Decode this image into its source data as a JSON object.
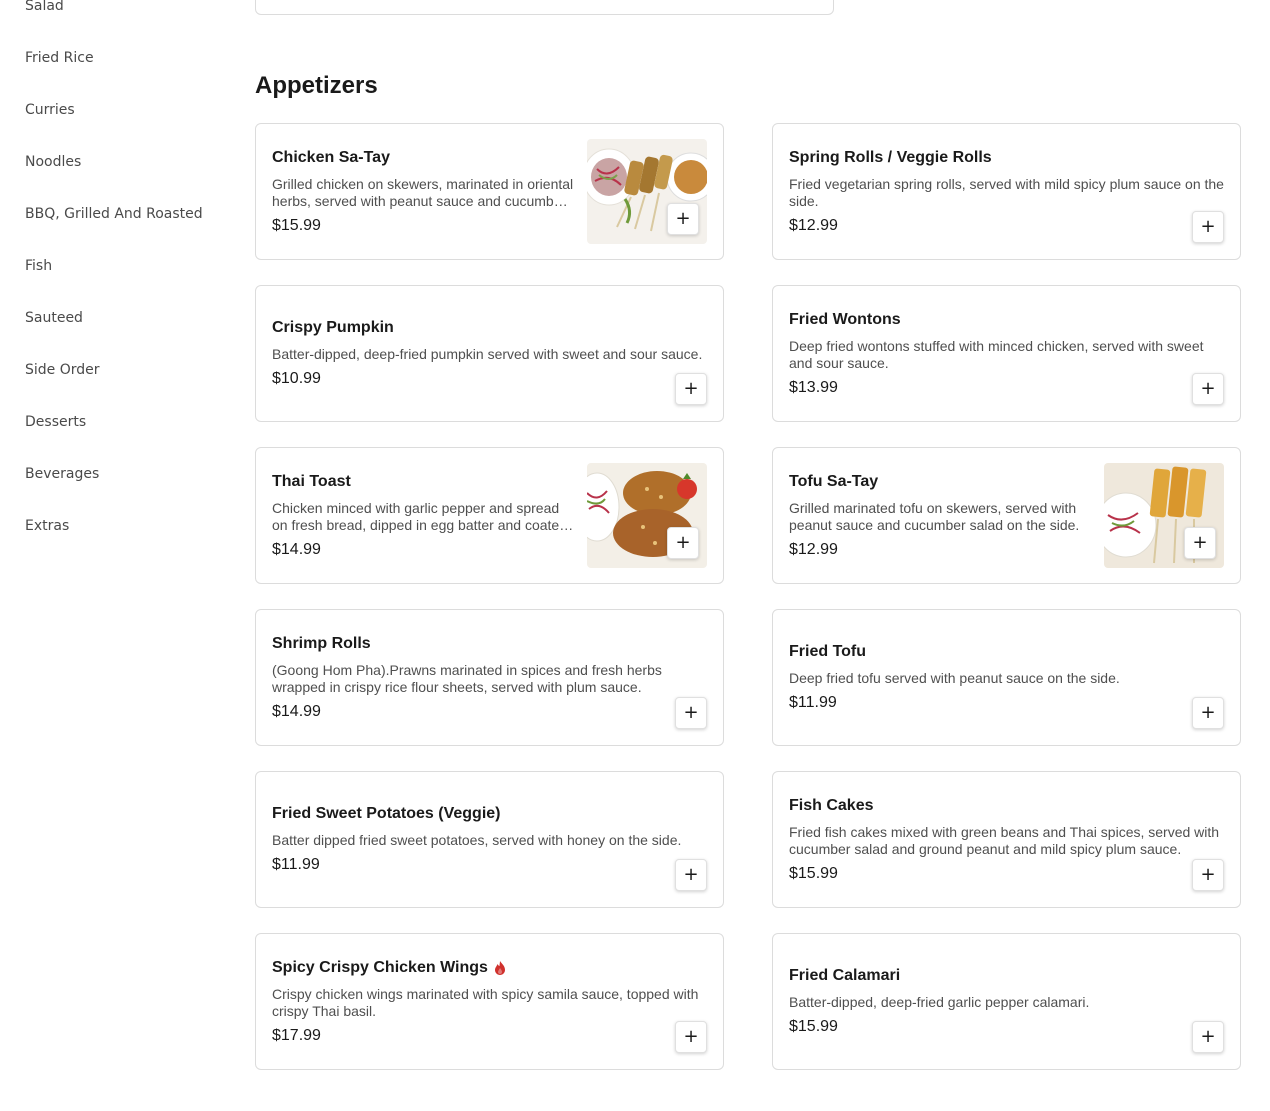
{
  "sidebar": {
    "items": [
      {
        "label": "Salad"
      },
      {
        "label": "Fried Rice"
      },
      {
        "label": "Curries"
      },
      {
        "label": "Noodles"
      },
      {
        "label": "BBQ, Grilled And Roasted"
      },
      {
        "label": "Fish"
      },
      {
        "label": "Sauteed"
      },
      {
        "label": "Side Order"
      },
      {
        "label": "Desserts"
      },
      {
        "label": "Beverages"
      },
      {
        "label": "Extras"
      }
    ]
  },
  "section": {
    "title": "Appetizers"
  },
  "add_label": "+",
  "items": [
    {
      "name": "Chicken Sa-Tay",
      "desc": "Grilled chicken on skewers, marinated in oriental herbs, served with peanut sauce and cucumber salad on the side.",
      "price": "$15.99",
      "image": "chicken-satay"
    },
    {
      "name": "Spring Rolls / Veggie Rolls",
      "desc": "Fried vegetarian spring rolls, served with mild spicy plum sauce on the side.",
      "price": "$12.99",
      "image": ""
    },
    {
      "name": "Crispy Pumpkin",
      "desc": "Batter-dipped, deep-fried pumpkin served with sweet and sour sauce.",
      "price": "$10.99",
      "image": ""
    },
    {
      "name": "Fried Wontons",
      "desc": "Deep fried wontons stuffed with minced chicken, served with sweet and sour sauce.",
      "price": "$13.99",
      "image": ""
    },
    {
      "name": "Thai Toast",
      "desc": "Chicken minced with garlic pepper and spread on fresh bread, dipped in egg batter and coated with sesame seeds.",
      "price": "$14.99",
      "image": "thai-toast"
    },
    {
      "name": "Tofu Sa-Tay",
      "desc": "Grilled marinated tofu on skewers, served with peanut sauce and cucumber salad on the side.",
      "price": "$12.99",
      "image": "tofu-satay"
    },
    {
      "name": "Shrimp Rolls",
      "desc": "(Goong Hom Pha).Prawns marinated in spices and fresh herbs wrapped in crispy rice flour sheets, served with plum sauce.",
      "price": "$14.99",
      "image": ""
    },
    {
      "name": "Fried Tofu",
      "desc": "Deep fried tofu served with peanut sauce on the side.",
      "price": "$11.99",
      "image": ""
    },
    {
      "name": "Fried Sweet Potatoes (Veggie)",
      "desc": "Batter dipped fried sweet potatoes, served with honey on the side.",
      "price": "$11.99",
      "image": ""
    },
    {
      "name": "Fish Cakes",
      "desc": "Fried fish cakes mixed with green beans and Thai spices, served with cucumber salad and ground peanut and mild spicy plum sauce.",
      "price": "$15.99",
      "image": ""
    },
    {
      "name": "Spicy Crispy Chicken Wings",
      "desc": "Crispy chicken wings marinated with spicy samila sauce, topped with crispy Thai basil.",
      "price": "$17.99",
      "image": "",
      "spicy": true
    },
    {
      "name": "Fried Calamari",
      "desc": "Batter-dipped, deep-fried garlic pepper calamari.",
      "price": "$15.99",
      "image": ""
    }
  ],
  "colors": {
    "border": "#dcdcdc",
    "text": "#1a1a1a",
    "muted": "#4f4f4f",
    "spicy": "#d0312d"
  }
}
